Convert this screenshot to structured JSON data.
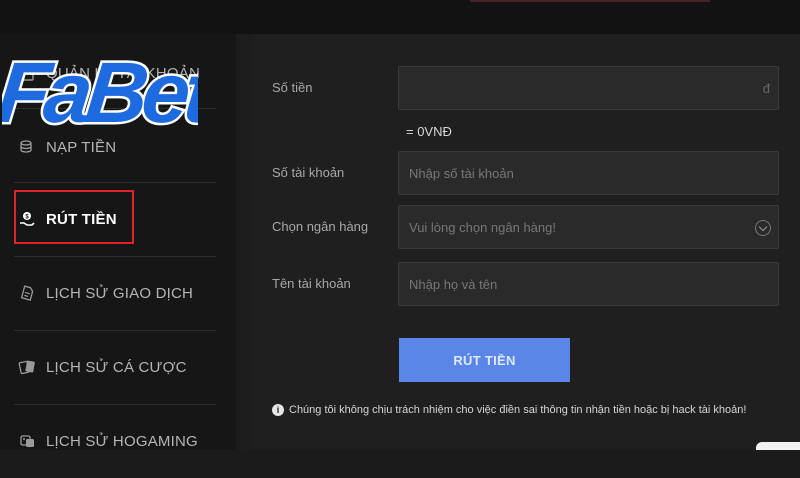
{
  "brand": {
    "logo_text": "FaBet"
  },
  "sidebar": {
    "items": [
      {
        "label": "QUẢN LÝ TÀI KHOẢN",
        "icon": "account-icon"
      },
      {
        "label": "NẠP TIỀN",
        "icon": "coin-stack-icon"
      },
      {
        "label": "RÚT TIỀN",
        "icon": "withdraw-hand-icon",
        "active": true
      },
      {
        "label": "LỊCH SỬ GIAO DỊCH",
        "icon": "transaction-history-icon"
      },
      {
        "label": "LỊCH SỬ CÁ CƯỢC",
        "icon": "cards-icon"
      },
      {
        "label": "LỊCH SỬ HOGAMING",
        "icon": "dice-icon"
      }
    ]
  },
  "form": {
    "amount": {
      "label": "Số tiền",
      "value": "",
      "suffix": "đ"
    },
    "conversion": "= 0VNĐ",
    "account_number": {
      "label": "Số tài khoản",
      "placeholder": "Nhập số tài khoản"
    },
    "bank": {
      "label": "Chọn ngân hàng",
      "placeholder": "Vui lòng chọn ngân hàng!"
    },
    "account_name": {
      "label": "Tên tài khoản",
      "placeholder": "Nhập họ và tên"
    },
    "submit_label": "RÚT TIỀN"
  },
  "notice": "Chúng tôi không chịu trách nhiệm cho việc điền sai thông tin nhận tiền hoặc bị hack tài khoản!",
  "colors": {
    "accent_blue": "#5a86e8",
    "highlight_red": "#e0222a",
    "logo_blue": "#1e6be0"
  }
}
